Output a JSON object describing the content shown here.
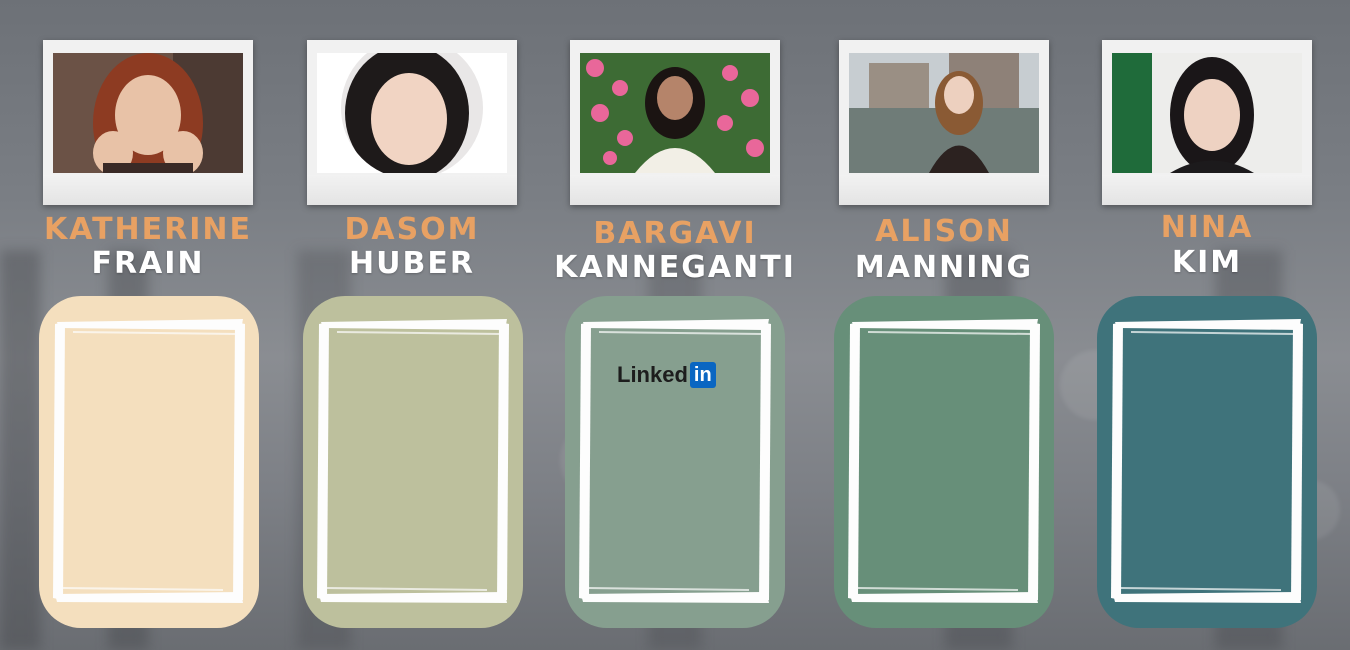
{
  "people": [
    {
      "first": "KATHERINE",
      "last": "FRAIN",
      "panel_color": "#f4dfbe",
      "photo_bg": "#6b5246",
      "hair": "#8d3b22",
      "skin": "#e8c2a7"
    },
    {
      "first": "DASOM",
      "last": "HUBER",
      "panel_color": "#bdc09d",
      "photo_bg": "#f4f4f4",
      "hair": "#1e1a1a",
      "skin": "#f1d4c3"
    },
    {
      "first": "BARGAVI",
      "last": "KANNEGANTI",
      "panel_color": "#869f8f",
      "photo_bg": "#3f7a3a",
      "hair": "#1b1412",
      "skin": "#b5846a",
      "link_label": "Linked",
      "link_badge": "in"
    },
    {
      "first": "ALISON",
      "last": "MANNING",
      "panel_color": "#678f79",
      "photo_bg": "#8c9aa2",
      "hair": "#8a5a34",
      "skin": "#edd0bf"
    },
    {
      "first": "NINA",
      "last": "KIM",
      "panel_color": "#3f737b",
      "photo_bg": "#ededeb",
      "hair": "#1a1618",
      "skin": "#eed2c2"
    }
  ]
}
